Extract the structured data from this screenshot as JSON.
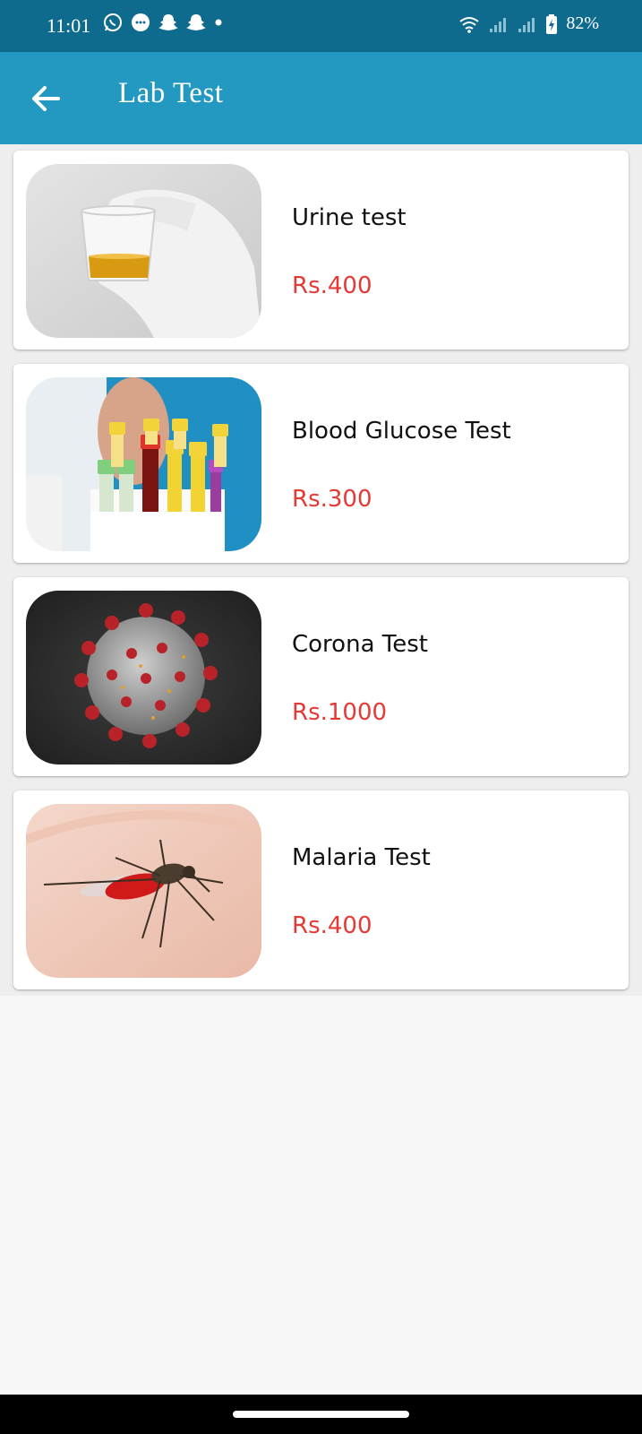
{
  "status_bar": {
    "time": "11:01",
    "battery_percent": "82%",
    "notification_icons": [
      "whatsapp-icon",
      "messages-icon",
      "snapchat-icon",
      "snapchat-icon",
      "dot-icon"
    ],
    "system_icons": [
      "wifi-icon",
      "signal-icon",
      "signal-icon",
      "battery-icon"
    ]
  },
  "app_bar": {
    "title": "Lab Test",
    "back_icon": "arrow-left-icon",
    "color": "#2399c1"
  },
  "tests": [
    {
      "name": "Urine test",
      "price": "Rs.400",
      "image": "urine-sample-image"
    },
    {
      "name": "Blood Glucose Test",
      "price": "Rs.300",
      "image": "blood-tubes-image"
    },
    {
      "name": "Corona Test",
      "price": "Rs.1000",
      "image": "coronavirus-image"
    },
    {
      "name": "Malaria Test",
      "price": "Rs.400",
      "image": "mosquito-image"
    }
  ],
  "colors": {
    "status_bar": "#0f6b8e",
    "price": "#e53935",
    "background": "#f7f7f7"
  }
}
